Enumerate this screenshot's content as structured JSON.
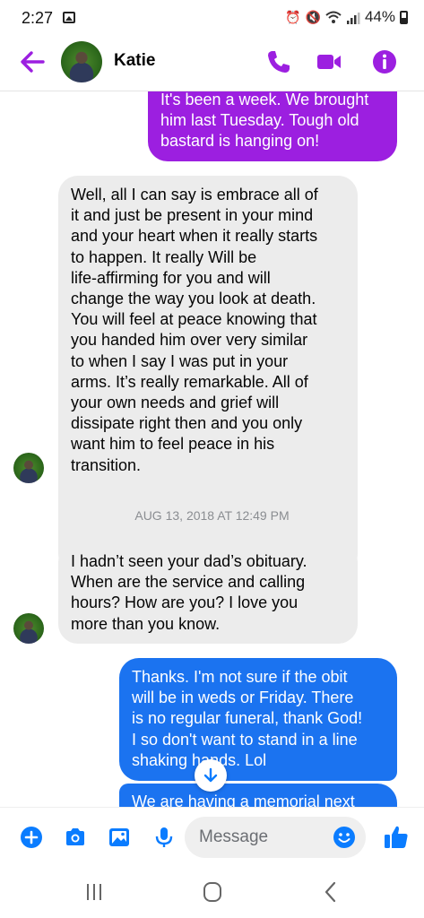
{
  "status_bar": {
    "time": "2:27",
    "battery": "44%"
  },
  "header": {
    "contact_name": "Katie"
  },
  "messages": [
    {
      "direction": "outgoing",
      "lines": [
        "It's been a week. We brought",
        "him last Tuesday. Tough old",
        "bastard is hanging on!"
      ]
    },
    {
      "direction": "incoming",
      "lines": [
        "Well, all I can say is embrace all of",
        "it and just be present in your mind",
        "and your heart when it really starts",
        "to happen. It really Will be",
        "life-affirming for you and will",
        "change the way you look at death.",
        "You will feel at peace knowing that",
        "you handed him over very similar",
        "to when I say I was put in your",
        "arms. It’s really remarkable. All of",
        "your own needs and grief will",
        "dissipate right then and you only",
        "want him to feel peace in his",
        "transition."
      ]
    },
    {
      "direction": "incoming",
      "lines": [
        "I hadn’t seen your dad’s obituary.",
        "When are the service and calling",
        "hours?  How are you?  I love you",
        "more than you know."
      ]
    },
    {
      "direction": "outgoing",
      "lines": [
        "Thanks. I'm not sure if the obit",
        "will be in weds or Friday. There",
        "is no regular funeral, thank God!",
        "I so don't want to stand in a line",
        "shaking hands. Lol"
      ]
    },
    {
      "direction": "outgoing",
      "lines": [
        "We are having a memorial next"
      ]
    }
  ],
  "timestamp": "AUG 13, 2018 AT 12:49 PM",
  "composer": {
    "placeholder": "Message"
  },
  "colors": {
    "accent_purple": "#9c1fe0",
    "outgoing_blue": "#1b73f0",
    "incoming_gray": "#ececec",
    "messenger_blue": "#0a7cff"
  },
  "icons": [
    "back-arrow-icon",
    "phone-icon",
    "video-icon",
    "info-icon",
    "plus-icon",
    "camera-icon",
    "photo-icon",
    "mic-icon",
    "emoji-icon",
    "thumbs-up-icon",
    "scroll-down-icon"
  ]
}
